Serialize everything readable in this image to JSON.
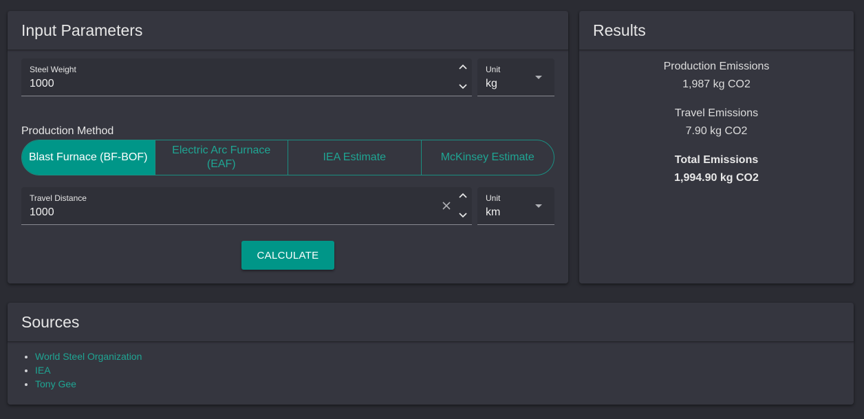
{
  "input_card": {
    "title": "Input Parameters",
    "steel_weight": {
      "label": "Steel Weight",
      "value": "1000"
    },
    "weight_unit": {
      "label": "Unit",
      "value": "kg"
    },
    "production_method": {
      "label": "Production Method",
      "options": [
        "Blast Furnace (BF-BOF)",
        "Electric Arc Furnace (EAF)",
        "IEA Estimate",
        "McKinsey Estimate"
      ],
      "selected": "Blast Furnace (BF-BOF)"
    },
    "travel_distance": {
      "label": "Travel Distance",
      "value": "1000"
    },
    "distance_unit": {
      "label": "Unit",
      "value": "km"
    },
    "calculate_label": "CALCULATE"
  },
  "results_card": {
    "title": "Results",
    "production": {
      "label": "Production Emissions",
      "value": "1,987 kg CO2"
    },
    "travel": {
      "label": "Travel Emissions",
      "value": "7.90 kg CO2"
    },
    "total": {
      "label": "Total Emissions",
      "value": "1,994.90 kg CO2"
    }
  },
  "sources_card": {
    "title": "Sources",
    "links": [
      "World Steel Organization",
      "IEA",
      "Tony Gee"
    ]
  },
  "colors": {
    "accent": "#009688",
    "background": "#2b2c33",
    "card": "#35363f"
  }
}
